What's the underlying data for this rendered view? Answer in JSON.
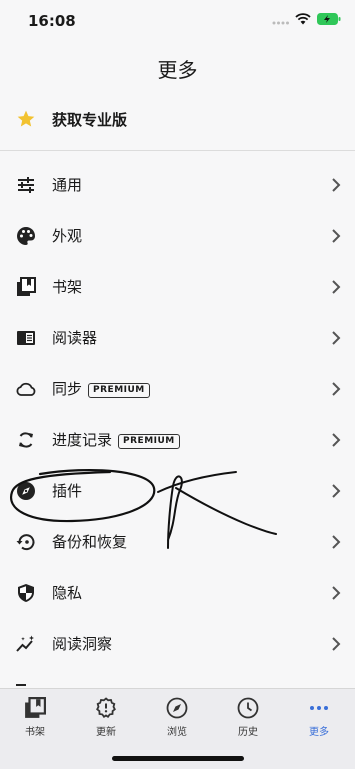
{
  "status_bar": {
    "time": "16:08"
  },
  "nav": {
    "title": "更多"
  },
  "pro": {
    "label": "获取专业版",
    "icon": "star-icon",
    "icon_color": "#f2c230"
  },
  "menu": [
    {
      "label": "通用",
      "icon": "sliders-icon"
    },
    {
      "label": "外观",
      "icon": "palette-icon"
    },
    {
      "label": "书架",
      "icon": "bookshelf-icon"
    },
    {
      "label": "阅读器",
      "icon": "reader-icon"
    },
    {
      "label": "同步",
      "icon": "cloud-icon",
      "badge": "PREMIUM"
    },
    {
      "label": "进度记录",
      "icon": "sync-arrows-icon",
      "badge": "PREMIUM"
    },
    {
      "label": "插件",
      "icon": "compass-icon"
    },
    {
      "label": "备份和恢复",
      "icon": "restore-icon"
    },
    {
      "label": "隐私",
      "icon": "shield-icon"
    },
    {
      "label": "阅读洞察",
      "icon": "insights-icon"
    }
  ],
  "tabbar": {
    "active_color": "#3a6fd8",
    "tabs": [
      {
        "label": "书架",
        "icon": "bookshelf-icon"
      },
      {
        "label": "更新",
        "icon": "alert-badge-icon"
      },
      {
        "label": "浏览",
        "icon": "compass-icon"
      },
      {
        "label": "历史",
        "icon": "clock-icon"
      },
      {
        "label": "更多",
        "icon": "more-dots-icon",
        "active": true
      }
    ]
  }
}
